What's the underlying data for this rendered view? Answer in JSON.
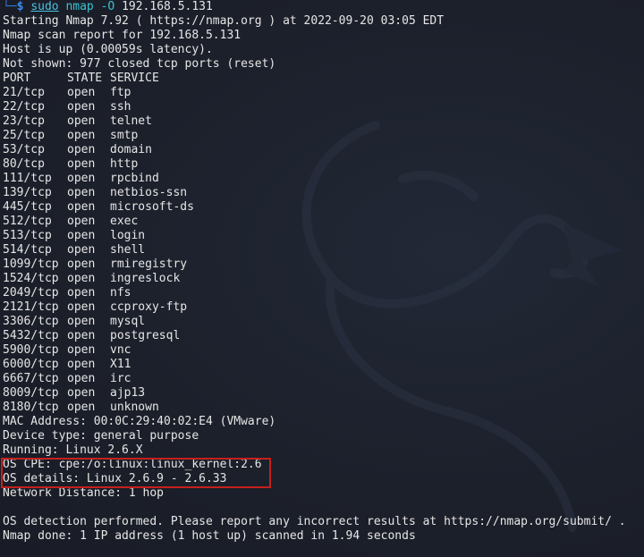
{
  "prompt": {
    "tree_glyph": "└─",
    "dollar": "$",
    "sudo": "sudo",
    "nmap": "nmap",
    "flag": "-O",
    "target": "192.168.5.131"
  },
  "header_lines": [
    "Starting Nmap 7.92 ( https://nmap.org ) at 2022-09-20 03:05 EDT",
    "Nmap scan report for 192.168.5.131",
    "Host is up (0.00059s latency).",
    "Not shown: 977 closed tcp ports (reset)"
  ],
  "table_header": {
    "port": "PORT",
    "state": "STATE",
    "service": "SERVICE"
  },
  "ports": [
    {
      "port": "21/tcp",
      "state": "open",
      "service": "ftp"
    },
    {
      "port": "22/tcp",
      "state": "open",
      "service": "ssh"
    },
    {
      "port": "23/tcp",
      "state": "open",
      "service": "telnet"
    },
    {
      "port": "25/tcp",
      "state": "open",
      "service": "smtp"
    },
    {
      "port": "53/tcp",
      "state": "open",
      "service": "domain"
    },
    {
      "port": "80/tcp",
      "state": "open",
      "service": "http"
    },
    {
      "port": "111/tcp",
      "state": "open",
      "service": "rpcbind"
    },
    {
      "port": "139/tcp",
      "state": "open",
      "service": "netbios-ssn"
    },
    {
      "port": "445/tcp",
      "state": "open",
      "service": "microsoft-ds"
    },
    {
      "port": "512/tcp",
      "state": "open",
      "service": "exec"
    },
    {
      "port": "513/tcp",
      "state": "open",
      "service": "login"
    },
    {
      "port": "514/tcp",
      "state": "open",
      "service": "shell"
    },
    {
      "port": "1099/tcp",
      "state": "open",
      "service": "rmiregistry"
    },
    {
      "port": "1524/tcp",
      "state": "open",
      "service": "ingreslock"
    },
    {
      "port": "2049/tcp",
      "state": "open",
      "service": "nfs"
    },
    {
      "port": "2121/tcp",
      "state": "open",
      "service": "ccproxy-ftp"
    },
    {
      "port": "3306/tcp",
      "state": "open",
      "service": "mysql"
    },
    {
      "port": "5432/tcp",
      "state": "open",
      "service": "postgresql"
    },
    {
      "port": "5900/tcp",
      "state": "open",
      "service": "vnc"
    },
    {
      "port": "6000/tcp",
      "state": "open",
      "service": "X11"
    },
    {
      "port": "6667/tcp",
      "state": "open",
      "service": "irc"
    },
    {
      "port": "8009/tcp",
      "state": "open",
      "service": "ajp13"
    },
    {
      "port": "8180/tcp",
      "state": "open",
      "service": "unknown"
    }
  ],
  "host_info": {
    "mac": "MAC Address: 00:0C:29:40:02:E4 (VMware)",
    "device_type": "Device type: general purpose",
    "running": "Running: Linux 2.6.X",
    "os_cpe": "OS CPE: cpe:/o:linux:linux_kernel:2.6",
    "os_details": "OS details: Linux 2.6.9 - 2.6.33",
    "network_distance": "Network Distance: 1 hop"
  },
  "footer_lines": [
    "OS detection performed. Please report any incorrect results at https://nmap.org/submit/ .",
    "Nmap done: 1 IP address (1 host up) scanned in 1.94 seconds"
  ],
  "colors": {
    "background": "#1b1f2a",
    "text": "#e6e6e6",
    "prompt_blue": "#3b8be8",
    "command_cyan": "#3ac3d0",
    "highlight_red": "#c6201d"
  }
}
